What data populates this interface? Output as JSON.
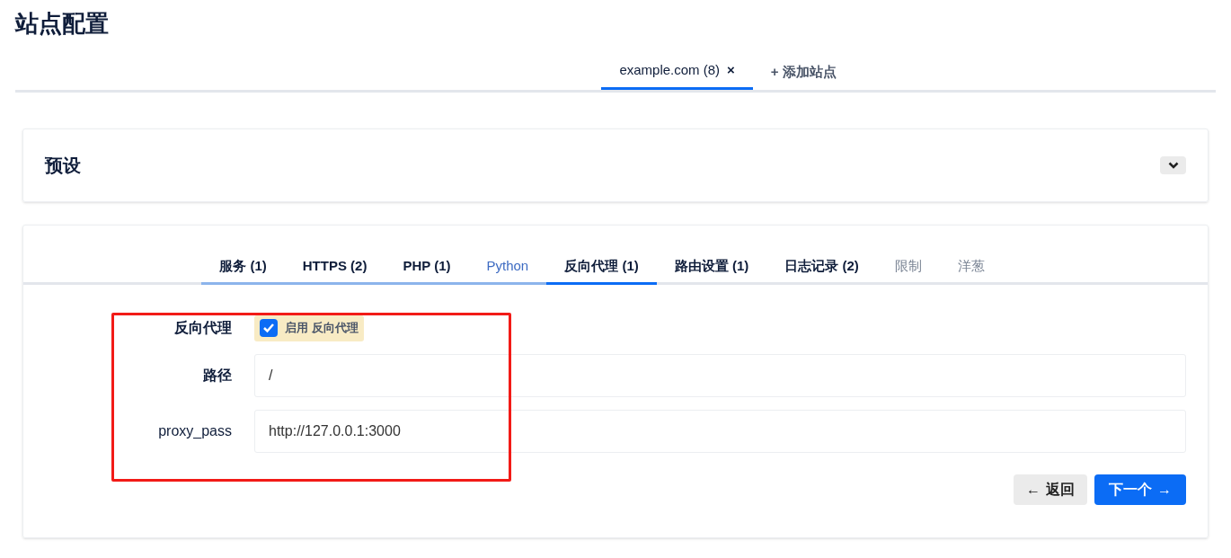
{
  "page_title": "站点配置",
  "site_tabs": [
    {
      "label": "example.com (8)",
      "close": "×",
      "selected": true
    }
  ],
  "add_site": {
    "icon": "+",
    "label": "添加站点"
  },
  "presets": {
    "title": "预设",
    "expanded": false
  },
  "step_tabs": [
    {
      "label": "服务 (1)",
      "kind": "done",
      "selected": false
    },
    {
      "label": "HTTPS (2)",
      "kind": "done",
      "selected": false
    },
    {
      "label": "PHP (1)",
      "kind": "done",
      "selected": false
    },
    {
      "label": "Python",
      "kind": "skipped",
      "selected": false
    },
    {
      "label": "反向代理 (1)",
      "kind": "done",
      "selected": true
    },
    {
      "label": "路由设置 (1)",
      "kind": "pending",
      "selected": false
    },
    {
      "label": "日志记录 (2)",
      "kind": "pending",
      "selected": false
    },
    {
      "label": "限制",
      "kind": "empty",
      "selected": false
    },
    {
      "label": "洋葱",
      "kind": "empty",
      "selected": false
    }
  ],
  "form": {
    "enable": {
      "label": "反向代理",
      "checkbox_label": "启用 反向代理",
      "checked": true
    },
    "fields": [
      {
        "label": "路径",
        "value": "/"
      },
      {
        "label": "proxy_pass",
        "value": "http://127.0.0.1:3000"
      }
    ]
  },
  "buttons": {
    "back": {
      "arrow": "←",
      "label": "返回"
    },
    "next": {
      "label": "下一个",
      "arrow": "→"
    }
  }
}
